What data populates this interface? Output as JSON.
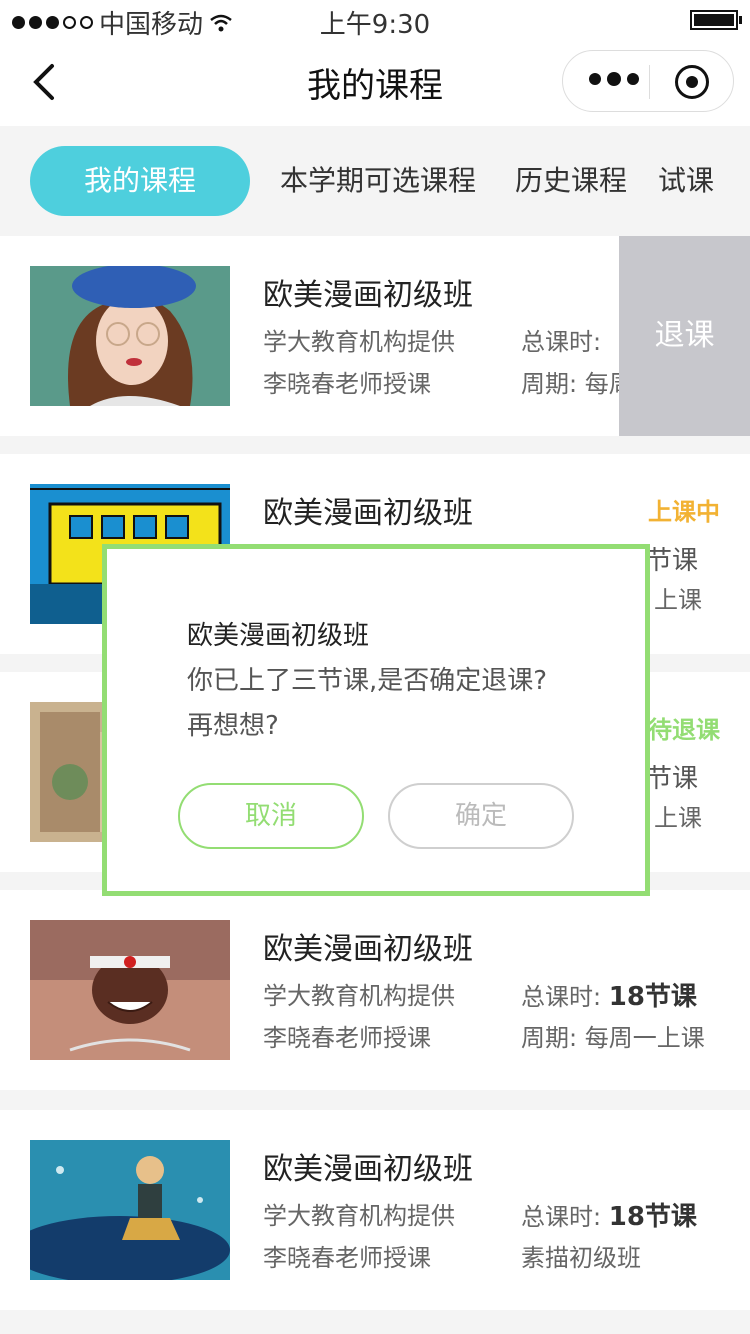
{
  "status_bar": {
    "carrier": "中国移动",
    "time": "上午9:30"
  },
  "nav": {
    "title": "我的课程"
  },
  "tabs": [
    {
      "label": "我的课程",
      "active": true
    },
    {
      "label": "本学期可选课程",
      "active": false
    },
    {
      "label": "历史课程",
      "active": false
    },
    {
      "label": "试课",
      "active": false
    }
  ],
  "courses": [
    {
      "title": "欧美漫画初级班",
      "org": "学大教育机构提供",
      "teacher": "李晓春老师授课",
      "hours_label": "总课时:",
      "hours_value": "",
      "cycle": "周期: 每周",
      "status": "",
      "action": "退课"
    },
    {
      "title": "欧美漫画初级班",
      "org": "",
      "teacher": "",
      "hours_label": "",
      "hours_value": "节课",
      "cycle": "上课",
      "status": "上课中",
      "status_color": "#f2b233"
    },
    {
      "title": "",
      "org": "",
      "teacher": "",
      "hours_label": "",
      "hours_value": "节课",
      "cycle": "上课",
      "status": "待退课",
      "status_color": "#93dd73"
    },
    {
      "title": "欧美漫画初级班",
      "org": "学大教育机构提供",
      "teacher": "李晓春老师授课",
      "hours_label": "总课时:",
      "hours_value": "18节课",
      "cycle": "周期: 每周一上课",
      "status": ""
    },
    {
      "title": "欧美漫画初级班",
      "org": "学大教育机构提供",
      "teacher": "李晓春老师授课",
      "hours_label": "总课时:",
      "hours_value": "18节课",
      "cycle": "素描初级班",
      "status": ""
    }
  ],
  "modal": {
    "title": "欧美漫画初级班",
    "message": "你已上了三节课,是否确定退课?",
    "message2": "再想想?",
    "cancel": "取消",
    "confirm": "确定",
    "border_color": "#93dd73"
  },
  "colors": {
    "accent": "#4ecfdd",
    "green": "#93dd73",
    "orange": "#f2b233",
    "gray_action": "#c7c7cc"
  }
}
